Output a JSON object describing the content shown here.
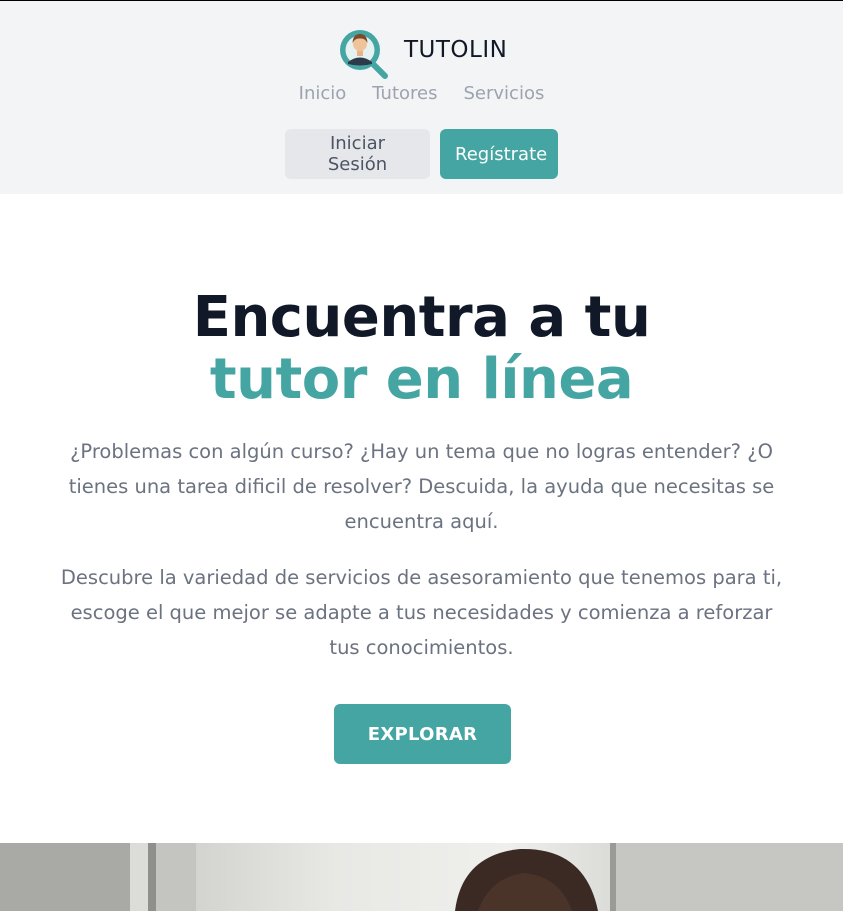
{
  "brand": {
    "name": "TUTOLIN",
    "logo_icon": "magnifier-tutor-avatar-icon",
    "accent_color": "#45a5a3"
  },
  "nav": {
    "items": [
      {
        "label": "Inicio"
      },
      {
        "label": "Tutores"
      },
      {
        "label": "Servicios"
      }
    ]
  },
  "auth": {
    "login_label": "Iniciar Sesión",
    "register_label": "Regístrate"
  },
  "hero": {
    "title_line1": "Encuentra a tu",
    "title_line2": "tutor en línea",
    "paragraph1": "¿Problemas con algún curso? ¿Hay un tema que no logras entender? ¿O tienes una tarea dificil de resolver? Descuida, la ayuda que necesitas se encuentra aquí.",
    "paragraph2": "Descubre la variedad de servicios de asesoramiento que tenemos para ti, escoge el que mejor se adapte a tus necesidades y comienza a reforzar tus conocimientos.",
    "cta_label": "EXPLORAR"
  },
  "image": {
    "description_icon": "student-photo"
  }
}
